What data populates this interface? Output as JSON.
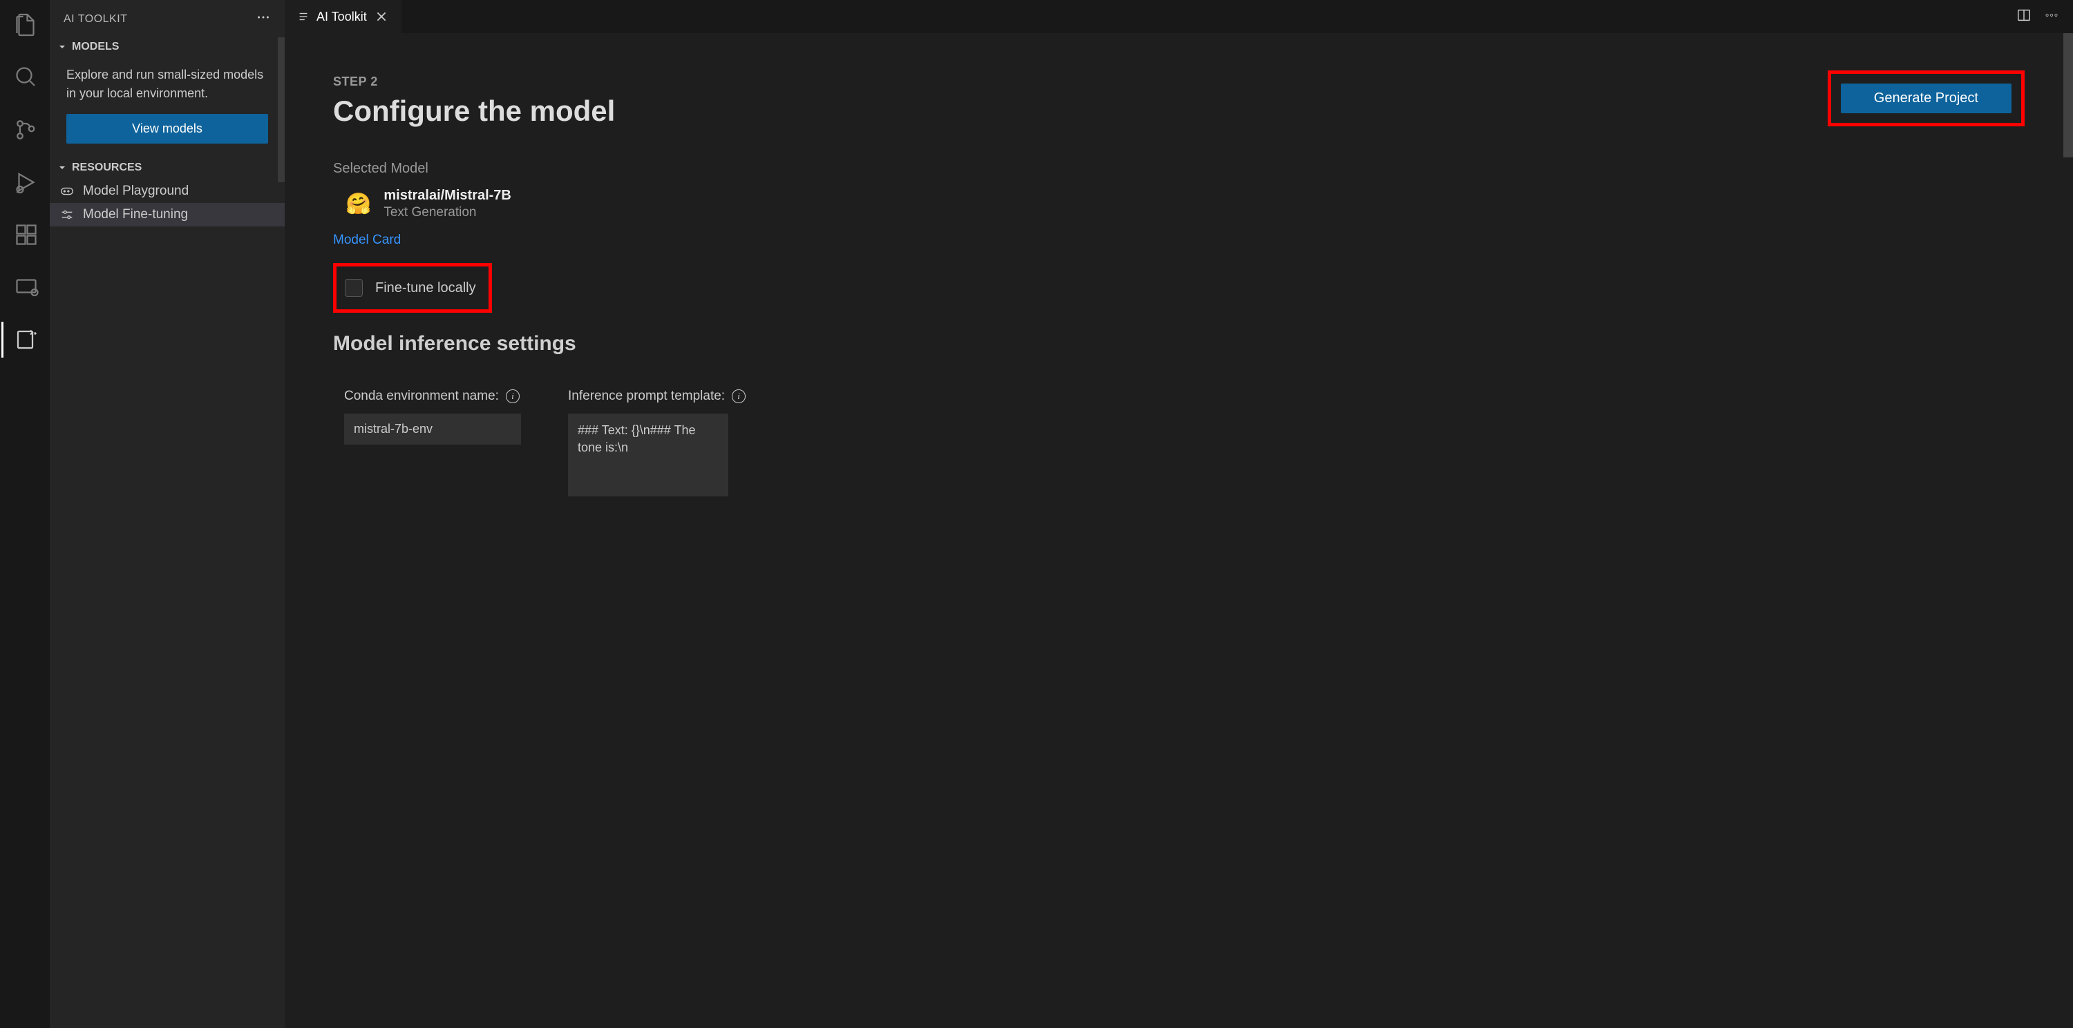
{
  "sidebar": {
    "title": "AI TOOLKIT",
    "sections": {
      "models": {
        "label": "MODELS",
        "description": "Explore and run small-sized models in your local environment.",
        "button": "View models"
      },
      "resources": {
        "label": "RESOURCES",
        "items": [
          {
            "label": "Model Playground"
          },
          {
            "label": "Model Fine-tuning"
          }
        ]
      }
    }
  },
  "tab": {
    "title": "AI Toolkit"
  },
  "content": {
    "step": "STEP 2",
    "title": "Configure the model",
    "generate_button": "Generate Project",
    "selected_model_label": "Selected Model",
    "model": {
      "name": "mistralai/Mistral-7B",
      "task": "Text Generation",
      "emoji": "🤗"
    },
    "model_card_link": "Model Card",
    "fine_tune_locally": "Fine-tune locally",
    "inference_title": "Model inference settings",
    "fields": {
      "conda": {
        "label": "Conda environment name:",
        "value": "mistral-7b-env"
      },
      "prompt": {
        "label": "Inference prompt template:",
        "value": "### Text: {}\\n### The tone is:\\n"
      }
    }
  }
}
